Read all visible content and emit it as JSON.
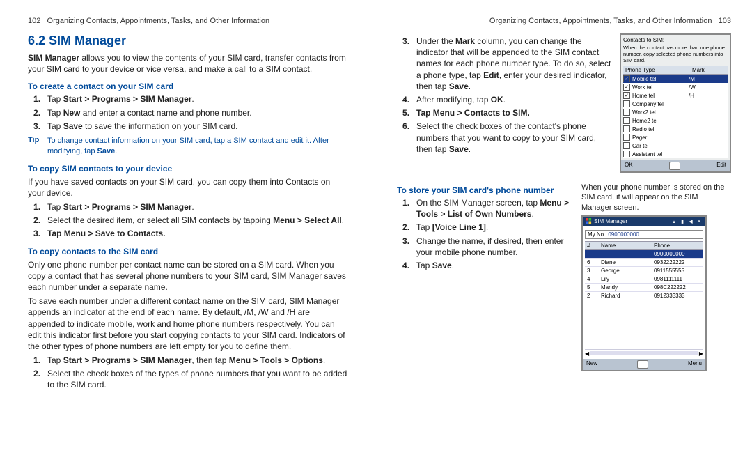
{
  "left": {
    "runhead_pn": "102",
    "runhead_txt": "Organizing Contacts, Appointments, Tasks, and Other Information",
    "title": "6.2  SIM Manager",
    "intro_b": "SIM Manager",
    "intro_rest": " allows you to view the contents of your SIM card, transfer contacts from your SIM card to your device or vice versa, and make a call to a SIM contact.",
    "sub1": "To create a contact on your SIM card",
    "s1": {
      "a_pre": "Tap ",
      "a_b": "Start > Programs > SIM Manager",
      "a_post": ".",
      "b_pre": "Tap ",
      "b_b": "New",
      "b_post": " and enter a contact name and phone number.",
      "c_pre": "Tap ",
      "c_b": "Save",
      "c_post": " to save the information on your SIM card."
    },
    "tip_label": "Tip",
    "tip_pre": "To change contact information on your SIM card, tap a SIM contact and edit it. After modifying, tap ",
    "tip_b": "Save",
    "tip_post": ".",
    "sub2": "To copy SIM contacts to your device",
    "p2": "If you have saved contacts on your SIM card, you can copy them into Contacts on your device.",
    "s2": {
      "a_pre": "Tap ",
      "a_b": "Start > Programs > SIM Manager",
      "a_post": ".",
      "b_pre": "Select the desired item, or select all SIM contacts by tapping ",
      "b_b": "Menu > Select All",
      "b_post": ".",
      "c_pre": "Tap ",
      "c_b": "Menu > Save to Contacts",
      "c_post": "."
    },
    "sub3": "To copy contacts to the SIM card",
    "p3a": "Only one phone number per contact name can be stored on a SIM card. When you copy a contact that has several phone numbers to your SIM card, SIM Manager saves each number under a separate name.",
    "p3b": "To save each number under a different contact name on the SIM card, SIM Manager appends an indicator at the end of each name. By default, /M, /W and /H are appended to indicate mobile, work and home phone numbers respectively. You can edit this indicator first before you start copying contacts to your SIM card. Indicators of the other types of phone numbers are left empty for you to define them.",
    "s3": {
      "a_pre": "Tap ",
      "a_b1": "Start > Programs > SIM Manager",
      "a_mid": ", then tap ",
      "a_b2": "Menu > Tools > Options",
      "a_post": ".",
      "b": "Select the check boxes of the types of phone numbers that you want to be added to the SIM card."
    }
  },
  "right": {
    "runhead_txt": "Organizing Contacts, Appointments, Tasks, and Other Information",
    "runhead_pn": "103",
    "s3c": {
      "c_pre": "Under the ",
      "c_b1": "Mark",
      "c_mid1": " column, you can change the indicator that will be appended to the SIM contact names for each phone number type. To do so, select a phone type, tap ",
      "c_b2": "Edit",
      "c_mid2": ", enter your desired indicator, then tap ",
      "c_b3": "Save",
      "c_post": ".",
      "d_pre": "After modifying, tap ",
      "d_b": "OK",
      "d_post": ".",
      "e_pre": "Tap ",
      "e_b": "Menu > Contacts to SIM",
      "e_post": ".",
      "f_pre": "Select the check boxes of the contact's phone numbers that you want to copy to your SIM card, then tap ",
      "f_b": "Save",
      "f_post": "."
    },
    "shot1": {
      "title": "Contacts to SIM:",
      "note": "When the contact has more than one phone number, copy selected phone numbers into SIM card.",
      "col_type": "Phone Type",
      "col_mark": "Mark",
      "rows": [
        {
          "checked": true,
          "t": "Mobile tel",
          "m": "/M"
        },
        {
          "checked": true,
          "t": "Work tel",
          "m": "/W"
        },
        {
          "checked": true,
          "t": "Home tel",
          "m": "/H"
        },
        {
          "checked": false,
          "t": "Company tel",
          "m": ""
        },
        {
          "checked": false,
          "t": "Work2 tel",
          "m": ""
        },
        {
          "checked": false,
          "t": "Home2 tel",
          "m": ""
        },
        {
          "checked": false,
          "t": "Radio tel",
          "m": ""
        },
        {
          "checked": false,
          "t": "Pager",
          "m": ""
        },
        {
          "checked": false,
          "t": "Car tel",
          "m": ""
        },
        {
          "checked": false,
          "t": "Assistant tel",
          "m": ""
        }
      ],
      "bb_left": "OK",
      "bb_right": "Edit"
    },
    "caption1": "When your phone number is stored on the SIM card, it will appear on the SIM Manager screen.",
    "sub4": "To store your SIM card's phone number",
    "s4": {
      "a_pre": "On the SIM Manager screen, tap ",
      "a_b": "Menu > Tools > List of Own Numbers",
      "a_post": ".",
      "b_pre": "Tap ",
      "b_b": "[Voice Line 1]",
      "b_post": ".",
      "c": "Change the name, if desired, then enter your mobile phone number.",
      "d_pre": "Tap ",
      "d_b": "Save",
      "d_post": "."
    },
    "shot2": {
      "title": "SIM Manager",
      "myno_lbl": "My No.",
      "myno_val": "0900000000",
      "col_num": "#",
      "col_name": "Name",
      "col_phone": "Phone",
      "rows": [
        {
          "n": "",
          "name": "",
          "phone": "0900000000",
          "sel": true
        },
        {
          "n": "6",
          "name": "Diane",
          "phone": "0932222222"
        },
        {
          "n": "3",
          "name": "George",
          "phone": "0911555555"
        },
        {
          "n": "4",
          "name": "Lily",
          "phone": "0981111111"
        },
        {
          "n": "5",
          "name": "Mandy",
          "phone": "098C222222"
        },
        {
          "n": "2",
          "name": "Richard",
          "phone": "0912333333"
        }
      ],
      "bb_left": "New",
      "bb_right": "Menu"
    }
  }
}
